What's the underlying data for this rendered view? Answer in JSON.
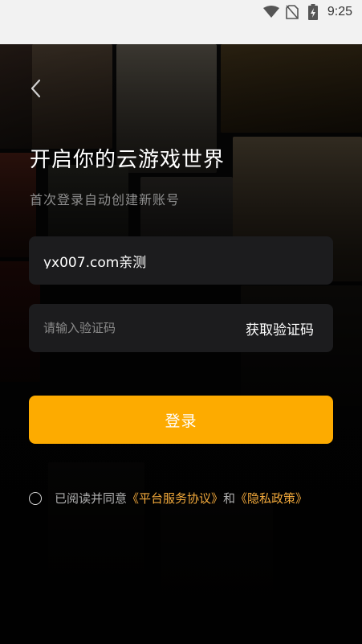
{
  "status_bar": {
    "time": "9:25",
    "icons": [
      "wifi-icon",
      "no-sim-icon",
      "battery-charging-icon"
    ]
  },
  "header": {
    "back_icon": "chevron-left-icon"
  },
  "main": {
    "title": "开启你的云游戏世界",
    "subtitle": "首次登录自动创建新账号",
    "phone_input": {
      "value": "yx007.com亲测"
    },
    "code_input": {
      "placeholder": "请输入验证码",
      "value": ""
    },
    "get_code_label": "获取验证码",
    "login_label": "登录"
  },
  "agreement": {
    "prefix": "已阅读并同意",
    "terms_label": "《平台服务协议》",
    "joiner": "和",
    "privacy_label": "《隐私政策》"
  },
  "colors": {
    "accent": "#fdab00",
    "link": "#f2a93b",
    "field_bg": "#1c1c1e"
  }
}
